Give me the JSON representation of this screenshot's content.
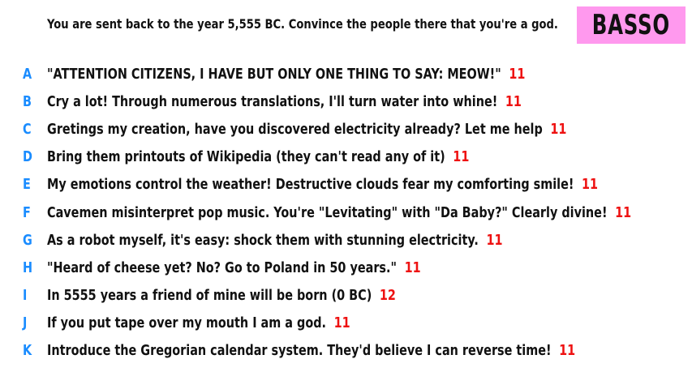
{
  "prompt": "You are sent back to the year 5,555 BC. Convince the people there that you're a god.",
  "player": "BASSO",
  "colors": {
    "letter": "#1a8cff",
    "score": "#ee1111",
    "badge": "#ff99ee",
    "text": "#111111"
  },
  "answers": [
    {
      "letter": "A",
      "text": "\"ATTENTION CITIZENS, I HAVE BUT ONLY ONE THING TO SAY: MEOW!\"",
      "score": "11"
    },
    {
      "letter": "B",
      "text": "Cry a lot! Through numerous translations, I'll turn water into whine!",
      "score": "11"
    },
    {
      "letter": "C",
      "text": "Gretings my creation, have you discovered electricity already? Let me help",
      "score": "11"
    },
    {
      "letter": "D",
      "text": "Bring them printouts of Wikipedia (they can't read any of it)",
      "score": "11"
    },
    {
      "letter": "E",
      "text": "My emotions control the weather! Destructive clouds fear my comforting smile!",
      "score": "11"
    },
    {
      "letter": "F",
      "text": "Cavemen misinterpret pop music. You're \"Levitating\" with \"Da Baby?\" Clearly divine!",
      "score": "11"
    },
    {
      "letter": "G",
      "text": "As a robot myself, it's easy: shock them with stunning electricity.",
      "score": "11"
    },
    {
      "letter": "H",
      "text": "\"Heard of cheese yet? No? Go to Poland in 50 years.\"",
      "score": "11"
    },
    {
      "letter": "I",
      "text": "In 5555 years a friend of mine will be born (0 BC)",
      "score": "12"
    },
    {
      "letter": "J",
      "text": "If you put tape over my mouth I am a god.",
      "score": "11"
    },
    {
      "letter": "K",
      "text": "Introduce the Gregorian calendar system. They'd believe I can reverse time!",
      "score": "11"
    }
  ]
}
